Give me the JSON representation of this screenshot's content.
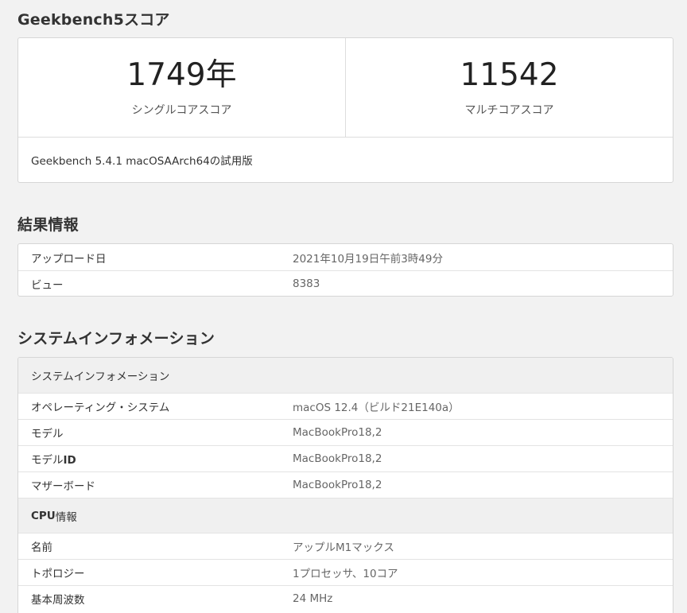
{
  "score_section": {
    "title": "Geekbench5スコア",
    "single": {
      "value": "1749年",
      "label": "シングルコアスコア"
    },
    "multi": {
      "value": "11542",
      "label": "マルチコアスコア"
    },
    "footer": "Geekbench 5.4.1 macOSAArch64の試用版"
  },
  "result_section": {
    "title": "結果情報",
    "rows": [
      {
        "key": "アップロード日",
        "value": "2021年10月19日午前3時49分"
      },
      {
        "key": "ビュー",
        "value": "8383"
      }
    ]
  },
  "system_section": {
    "title": "システムインフォメーション",
    "group1_title": "システムインフォメーション",
    "group1_rows": [
      {
        "key": "オペレーティング・システム",
        "value": "macOS 12.4（ビルド21E140a）"
      },
      {
        "key": "モデル",
        "value": "MacBookPro18,2"
      },
      {
        "key_prefix": "モデル",
        "key_strong": "ID",
        "value": "MacBookPro18,2"
      },
      {
        "key": "マザーボード",
        "value": "MacBookPro18,2"
      }
    ],
    "group2_title_strong": "CPU",
    "group2_title_rest": "情報",
    "group2_rows": [
      {
        "key": "名前",
        "value": "アップルM1マックス"
      },
      {
        "key": "トポロジー",
        "value": "1プロセッサ、10コア"
      },
      {
        "key": "基本周波数",
        "value": "24 MHz"
      }
    ]
  }
}
